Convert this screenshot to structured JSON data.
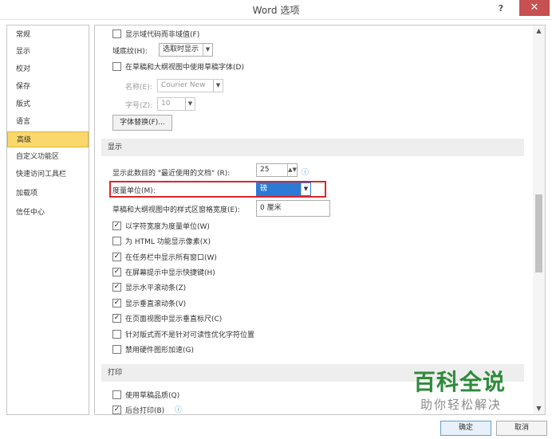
{
  "window": {
    "title": "Word 选项",
    "help_label": "?",
    "close_label": "✕"
  },
  "sidebar": {
    "items": [
      {
        "label": "常规"
      },
      {
        "label": "显示"
      },
      {
        "label": "校对"
      },
      {
        "label": "保存"
      },
      {
        "label": "版式"
      },
      {
        "label": "语言"
      },
      {
        "label": "高级",
        "selected": true
      },
      {
        "label": "自定义功能区"
      },
      {
        "label": "快速访问工具栏"
      },
      {
        "label": "加载项"
      },
      {
        "label": "信任中心"
      }
    ]
  },
  "advanced": {
    "show_field_codes": {
      "label": "显示域代码而非域值(F)",
      "checked": false
    },
    "field_shading": {
      "label": "域底纹(H):",
      "value": "选取时显示"
    },
    "draft_font": {
      "label": "在草稿和大纲视图中使用草稿字体(D)",
      "checked": false
    },
    "font_name": {
      "label": "名称(E):",
      "value": "Courier New"
    },
    "font_size": {
      "label": "字号(Z):",
      "value": "10"
    },
    "font_subst_button": "字体替换(F)...",
    "display_section": "显示",
    "recent_docs": {
      "label": "显示此数目的 \"最近使用的文档\" (R):",
      "value": "25",
      "info_icon": "ⓘ"
    },
    "measure_unit": {
      "label": "度量单位(M):",
      "value": "磅"
    },
    "style_area_width": {
      "label": "草稿和大纲视图中的样式区窗格宽度(E):",
      "value": "0 厘米"
    },
    "checks": [
      {
        "label": "以字符宽度为度量单位(W)",
        "checked": true
      },
      {
        "label": "为 HTML 功能显示像素(X)",
        "checked": false
      },
      {
        "label": "在任务栏中显示所有窗口(W)",
        "checked": true
      },
      {
        "label": "在屏幕提示中显示快捷键(H)",
        "checked": true
      },
      {
        "label": "显示水平滚动条(Z)",
        "checked": true
      },
      {
        "label": "显示垂直滚动条(V)",
        "checked": true
      },
      {
        "label": "在页面视图中显示垂直标尺(C)",
        "checked": true
      },
      {
        "label": "针对版式而不是针对可读性优化字符位置",
        "checked": false
      },
      {
        "label": "禁用硬件图形加速(G)",
        "checked": false
      }
    ],
    "print_section": "打印",
    "print_checks": [
      {
        "label": "使用草稿品质(Q)",
        "checked": false
      },
      {
        "label": "后台打印(B)",
        "checked": true,
        "info_icon": "ⓘ"
      }
    ]
  },
  "footer": {
    "ok_label": "确定",
    "cancel_label": "取消"
  },
  "watermark": {
    "title": "百科全说",
    "subtitle": "助你轻松解决"
  },
  "colors": {
    "selected_nav": "#fbd86b",
    "highlight_select": "#2a7ad6",
    "red_outline": "#d9262c",
    "watermark_green": "#2e8b3a"
  }
}
